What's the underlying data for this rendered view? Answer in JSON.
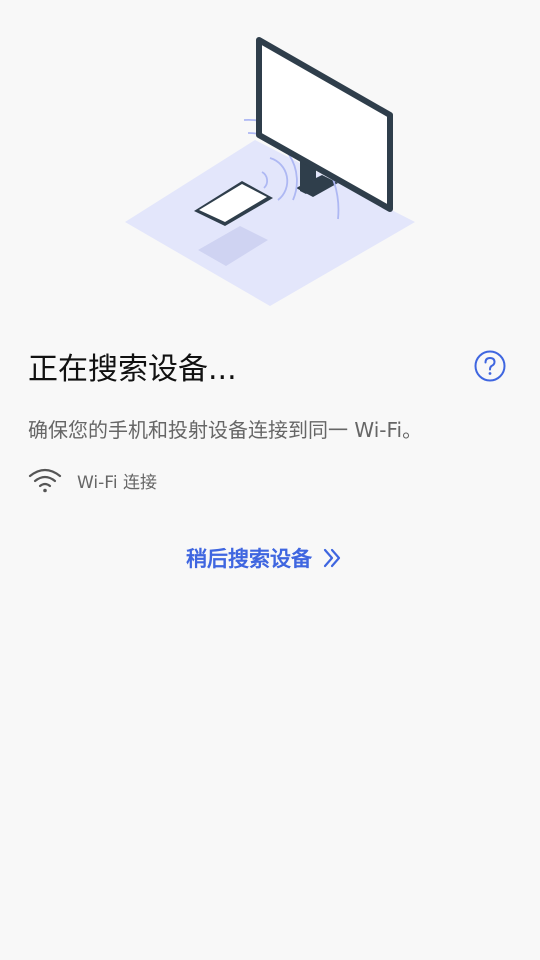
{
  "colors": {
    "background": "#f8f8f8",
    "accent": "#3f66e0",
    "title": "#111111",
    "secondary_text": "#666666",
    "illustration_floor": "#e3e6fb",
    "illustration_monitor": "#2f3e4b"
  },
  "illustration": {
    "icon": "phone-casting-to-monitor-illustration"
  },
  "header": {
    "title": "正在搜索设备...",
    "help_icon": "question-circle-icon"
  },
  "main": {
    "description": "确保您的手机和投射设备连接到同一 Wi-Fi。",
    "wifi": {
      "icon": "wifi-icon",
      "label": "Wi-Fi 连接"
    },
    "later_search": {
      "label": "稍后搜索设备",
      "icon": "double-chevron-right-icon"
    }
  }
}
